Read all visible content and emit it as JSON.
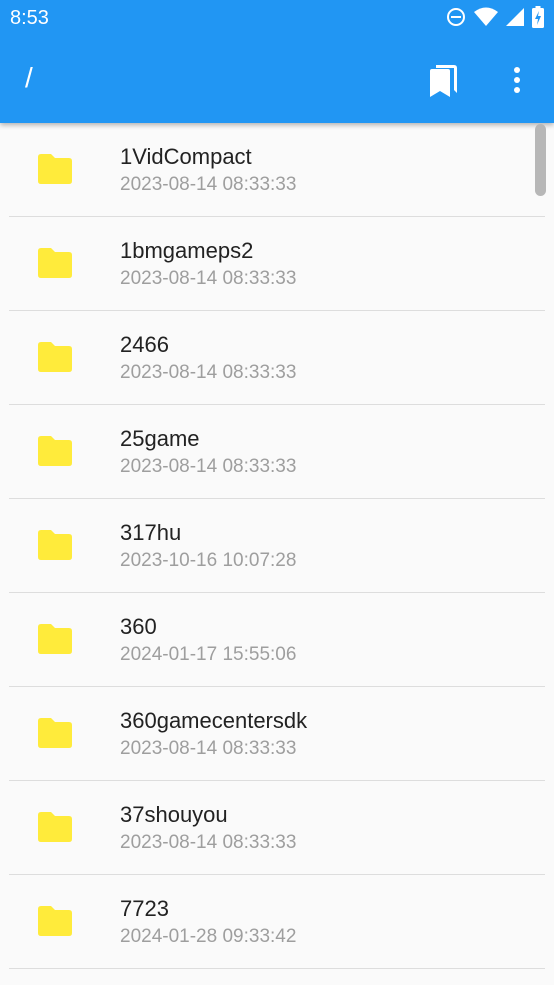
{
  "status_bar": {
    "time": "8:53",
    "icons": [
      "do-not-disturb-icon",
      "wifi-icon",
      "signal-icon",
      "battery-charging-icon"
    ]
  },
  "toolbar": {
    "title": "/",
    "bookmark_icon": "bookmark-icon",
    "menu_icon": "more-vert-icon"
  },
  "colors": {
    "app_bar": "#2196f3",
    "folder": "#ffeb3b",
    "background": "#fafafa",
    "divider": "#dddddd",
    "name_text": "#222222",
    "date_text": "#9e9e9e"
  },
  "files": [
    {
      "name": "1VidCompact",
      "date": "2023-08-14 08:33:33"
    },
    {
      "name": "1bmgameps2",
      "date": "2023-08-14 08:33:33"
    },
    {
      "name": "2466",
      "date": "2023-08-14 08:33:33"
    },
    {
      "name": "25game",
      "date": "2023-08-14 08:33:33"
    },
    {
      "name": "317hu",
      "date": "2023-10-16 10:07:28"
    },
    {
      "name": "360",
      "date": "2024-01-17 15:55:06"
    },
    {
      "name": "360gamecentersdk",
      "date": "2023-08-14 08:33:33"
    },
    {
      "name": "37shouyou",
      "date": "2023-08-14 08:33:33"
    },
    {
      "name": "7723",
      "date": "2024-01-28 09:33:42"
    }
  ]
}
